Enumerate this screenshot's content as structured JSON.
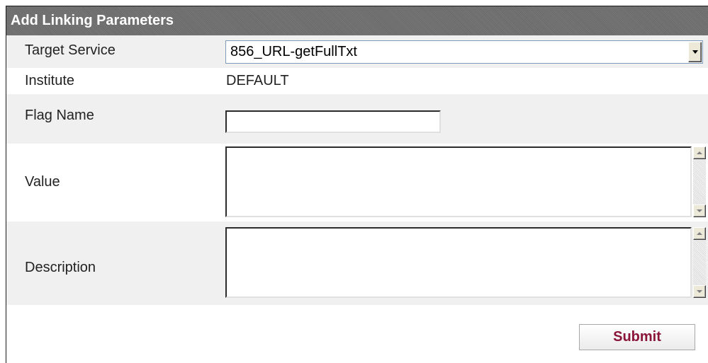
{
  "panel": {
    "title": "Add Linking Parameters"
  },
  "form": {
    "target_service": {
      "label": "Target Service",
      "selected": "856_URL-getFullTxt"
    },
    "institute": {
      "label": "Institute",
      "value": "DEFAULT"
    },
    "flag_name": {
      "label": "Flag Name",
      "value": ""
    },
    "value_field": {
      "label": "Value",
      "value": ""
    },
    "description": {
      "label": "Description",
      "value": ""
    },
    "submit_label": "Submit"
  },
  "icons": {
    "dropdown": "chevron-down-icon",
    "scroll_up": "scroll-up-arrow-icon",
    "scroll_down": "scroll-down-arrow-icon"
  },
  "colors": {
    "header_bg": "#6f6f6f",
    "row_shade": "#f0f0f0",
    "submit_text": "#8a1538"
  }
}
